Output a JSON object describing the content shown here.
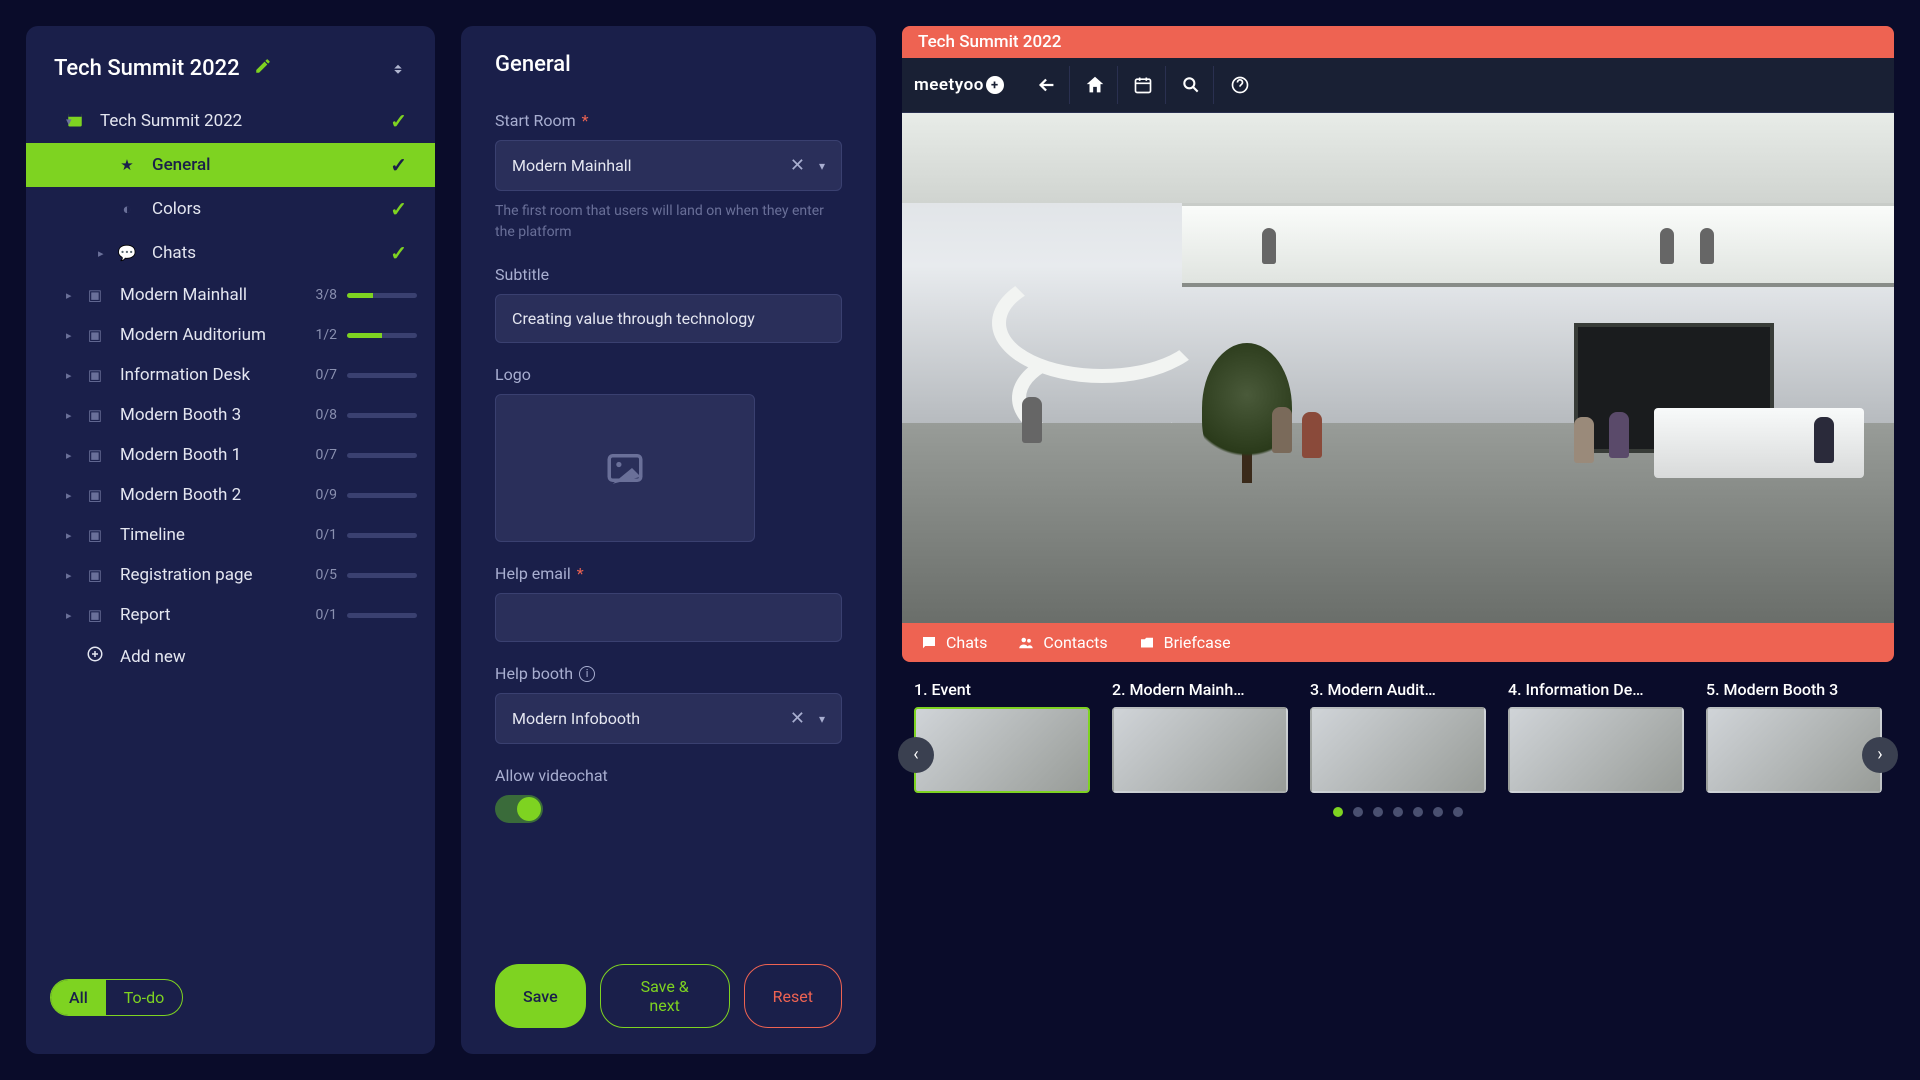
{
  "sidebar": {
    "title": "Tech Summit 2022",
    "root": {
      "label": "Tech Summit 2022",
      "checked": true
    },
    "children": [
      {
        "id": "general",
        "label": "General",
        "checked": true,
        "active": true
      },
      {
        "id": "colors",
        "label": "Colors",
        "checked": true
      },
      {
        "id": "chats",
        "label": "Chats",
        "checked": true,
        "hasArrow": true
      }
    ],
    "items": [
      {
        "id": "mainhall",
        "label": "Modern Mainhall",
        "progress": "3/8",
        "pct": 37
      },
      {
        "id": "auditorium",
        "label": "Modern Auditorium",
        "progress": "1/2",
        "pct": 50
      },
      {
        "id": "infodesk",
        "label": "Information Desk",
        "progress": "0/7",
        "pct": 0
      },
      {
        "id": "booth3",
        "label": "Modern Booth 3",
        "progress": "0/8",
        "pct": 0
      },
      {
        "id": "booth1",
        "label": "Modern Booth 1",
        "progress": "0/7",
        "pct": 0
      },
      {
        "id": "booth2",
        "label": "Modern Booth 2",
        "progress": "0/9",
        "pct": 0
      },
      {
        "id": "timeline",
        "label": "Timeline",
        "progress": "0/1",
        "pct": 0
      },
      {
        "id": "registration",
        "label": "Registration page",
        "progress": "0/5",
        "pct": 0
      },
      {
        "id": "report",
        "label": "Report",
        "progress": "0/1",
        "pct": 0
      }
    ],
    "add_label": "Add new",
    "filter": {
      "all": "All",
      "todo": "To-do"
    }
  },
  "form": {
    "title": "General",
    "start_room": {
      "label": "Start Room",
      "value": "Modern Mainhall",
      "helper": "The first room that users will land on when they enter the platform"
    },
    "subtitle": {
      "label": "Subtitle",
      "value": "Creating value through technology"
    },
    "logo": {
      "label": "Logo"
    },
    "help_email": {
      "label": "Help email",
      "value": ""
    },
    "help_booth": {
      "label": "Help booth",
      "value": "Modern Infobooth"
    },
    "allow_videochat": {
      "label": "Allow videochat",
      "on": true
    },
    "actions": {
      "save": "Save",
      "save_next": "Save & next",
      "reset": "Reset"
    }
  },
  "preview": {
    "title": "Tech Summit 2022",
    "logo": "meetyoo",
    "bottombar": {
      "chats": "Chats",
      "contacts": "Contacts",
      "briefcase": "Briefcase"
    },
    "thumbs": [
      {
        "label": "1. Event",
        "selected": true
      },
      {
        "label": "2. Modern Mainh…"
      },
      {
        "label": "3. Modern Audit…"
      },
      {
        "label": "4. Information De…"
      },
      {
        "label": "5. Modern Booth 3"
      }
    ],
    "dot_count": 7,
    "active_dot": 0
  }
}
